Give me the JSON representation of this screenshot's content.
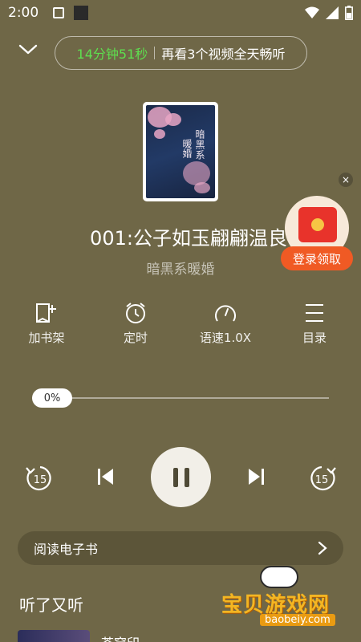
{
  "status_bar": {
    "time": "2:00",
    "icons": [
      "app-a-icon",
      "notification-square-icon",
      "wifi-icon",
      "cell-signal-icon",
      "battery-icon"
    ]
  },
  "header": {
    "collapse_icon": "chevron-down-icon",
    "timer_countdown": "14分钟51秒",
    "timer_prompt": "再看3个视频全天畅听",
    "countdown_color": "#5ee04f"
  },
  "cover": {
    "title_line1": "暗黑系",
    "title_line2": "暖婚"
  },
  "track": {
    "title": "001:公子如玉翩翩温良",
    "book": "暗黑系暖婚"
  },
  "promo": {
    "label": "登录领取",
    "close": "×"
  },
  "actions": [
    {
      "label": "加书架",
      "icon": "add-to-shelf-icon"
    },
    {
      "label": "定时",
      "icon": "alarm-clock-icon"
    },
    {
      "label": "语速1.0X",
      "icon": "speedometer-icon"
    },
    {
      "label": "目录",
      "icon": "menu-list-icon"
    }
  ],
  "progress": {
    "percent_label": "0%",
    "value": 0
  },
  "controls": {
    "rewind_seconds": "15",
    "forward_seconds": "15",
    "state": "playing"
  },
  "ebook": {
    "label": "阅读电子书"
  },
  "recommend": {
    "section_title": "听了又听",
    "first_item_title": "苍穹印"
  },
  "watermark": {
    "name": "宝贝游戏网",
    "url": "baobeiy.com"
  },
  "colors": {
    "background": "#6f6747",
    "accent_green": "#5ee04f",
    "promo_orange": "#f05a24",
    "envelope_red": "#e8332b"
  }
}
